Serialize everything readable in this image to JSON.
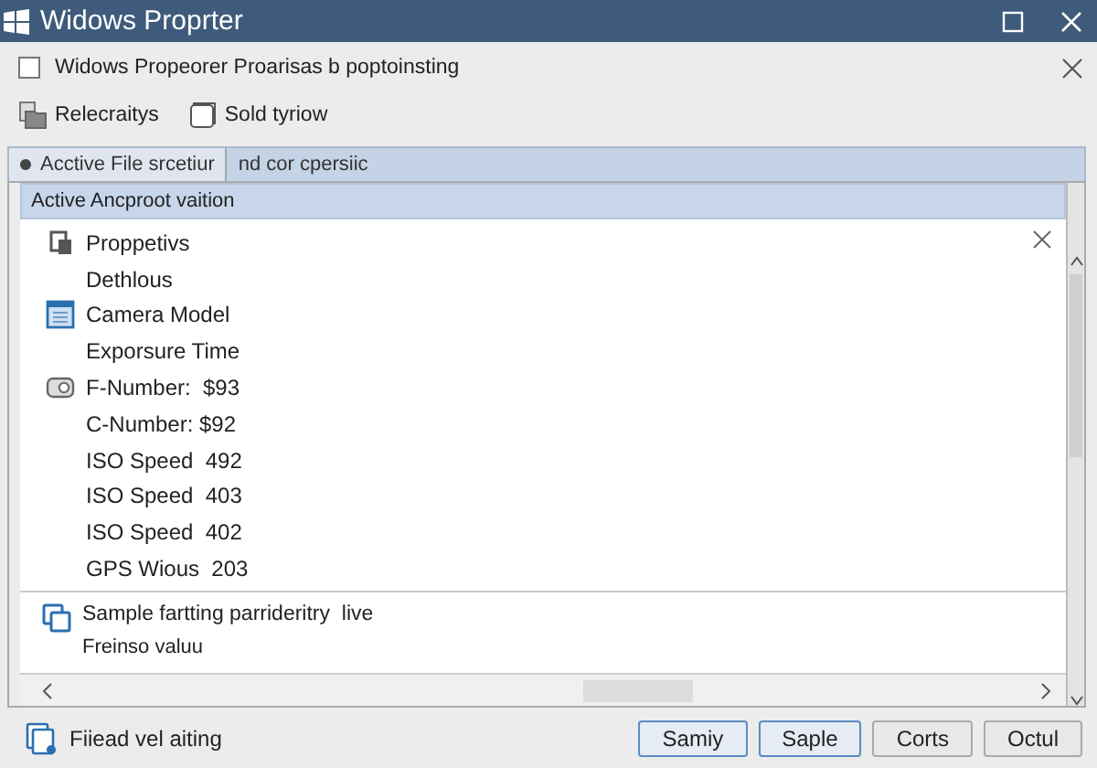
{
  "window": {
    "title": "Widows Proprter"
  },
  "banner": {
    "label": "Widows Propeorer Proarisas b poptoinsting",
    "checked": false
  },
  "toolbar": [
    {
      "label": "Relecraitys"
    },
    {
      "label": "Sold tyriow"
    }
  ],
  "tabs": [
    {
      "label": "Acctive File srcetiur",
      "selected": true
    },
    {
      "label": "nd cor cpersiic",
      "selected": false
    }
  ],
  "panel": {
    "header": "Active Ancproot vaition",
    "items": [
      {
        "label": "Proppetivs",
        "kind": "icon"
      },
      {
        "label": "Dethlous",
        "kind": "plain"
      },
      {
        "label": "Camera Model",
        "kind": "icon"
      },
      {
        "label": "Exporsure Time",
        "kind": "plain"
      },
      {
        "label": "F-Number:  $93",
        "kind": "icon"
      },
      {
        "label": "C-Number: $92",
        "kind": "plain"
      },
      {
        "label": "ISO Speed  492",
        "kind": "plain"
      },
      {
        "label": "ISO Speed  403",
        "kind": "plain"
      },
      {
        "label": "ISO Speed  402",
        "kind": "plain"
      },
      {
        "label": "GPS Wious  203",
        "kind": "plain"
      }
    ],
    "sample": {
      "title": "Sample fartting parrideritry  live",
      "value": "Freinso valuu"
    }
  },
  "status": {
    "text": "Fiiead vel aiting"
  },
  "buttons": [
    {
      "label": "Samiy",
      "focused": true
    },
    {
      "label": "Saple",
      "focused": true
    },
    {
      "label": "Corts",
      "focused": false
    },
    {
      "label": "Octul",
      "focused": false
    }
  ]
}
